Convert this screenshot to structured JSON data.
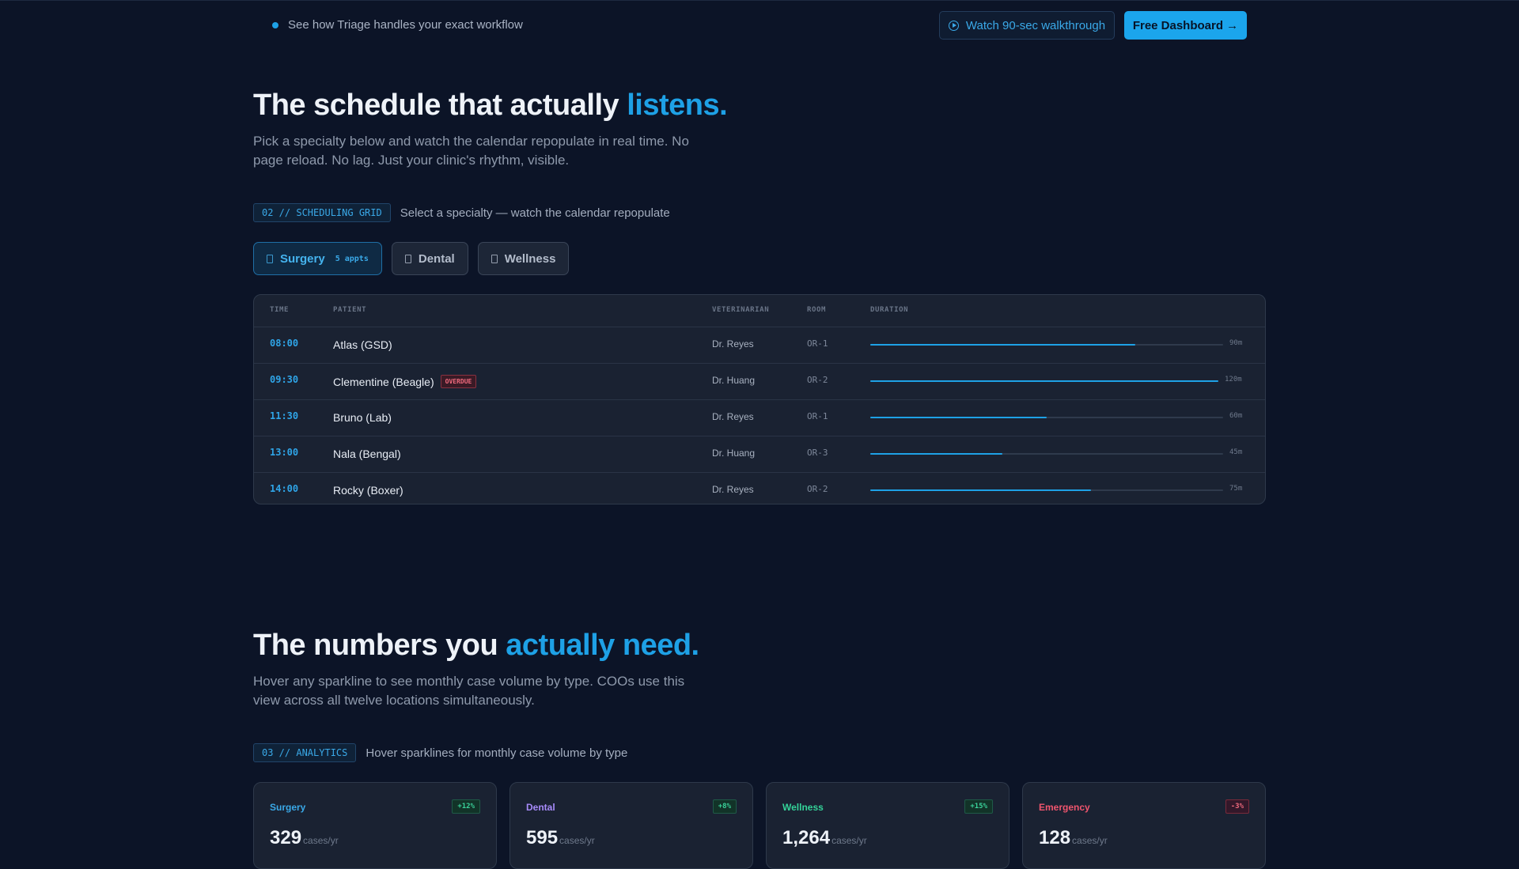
{
  "topbar": {
    "message": "See how Triage handles your exact workflow",
    "walkthrough_label": "Watch 90-sec walkthrough",
    "dashboard_label": "Free Dashboard →"
  },
  "scheduling": {
    "title_prefix": "The schedule that actually",
    "title_accent": "listens.",
    "lead": "Pick a specialty below and watch the calendar repopulate in real time. No page reload. No lag. Just your clinic's rhythm, visible.",
    "tag": "02 // SCHEDULING GRID",
    "tag_description": "Select a specialty — watch the calendar repopulate",
    "tabs": [
      {
        "label": "Surgery",
        "count": "5 appts",
        "active": true
      },
      {
        "label": "Dental",
        "count": "",
        "active": false
      },
      {
        "label": "Wellness",
        "count": "",
        "active": false
      }
    ],
    "columns": {
      "time": "TIME",
      "patient": "PATIENT",
      "vet": "VETERINARIAN",
      "room": "ROOM",
      "duration": "DURATION"
    },
    "overdue_label": "OVERDUE",
    "rows": [
      {
        "time": "08:00",
        "patient": "Atlas (GSD)",
        "overdue": false,
        "vet": "Dr. Reyes",
        "room": "OR-1",
        "duration": "90m",
        "minutes": 90
      },
      {
        "time": "09:30",
        "patient": "Clementine (Beagle)",
        "overdue": true,
        "vet": "Dr. Huang",
        "room": "OR-2",
        "duration": "120m",
        "minutes": 120
      },
      {
        "time": "11:30",
        "patient": "Bruno (Lab)",
        "overdue": false,
        "vet": "Dr. Reyes",
        "room": "OR-1",
        "duration": "60m",
        "minutes": 60
      },
      {
        "time": "13:00",
        "patient": "Nala (Bengal)",
        "overdue": false,
        "vet": "Dr. Huang",
        "room": "OR-3",
        "duration": "45m",
        "minutes": 45
      },
      {
        "time": "14:00",
        "patient": "Rocky (Boxer)",
        "overdue": false,
        "vet": "Dr. Reyes",
        "room": "OR-2",
        "duration": "75m",
        "minutes": 75
      }
    ],
    "accent_color": "#1ea1e6"
  },
  "analytics": {
    "title_prefix": "The numbers you",
    "title_accent": "actually need.",
    "lead": "Hover any sparkline to see monthly case volume by type. COOs use this view across all twelve locations simultaneously.",
    "tag": "03 // ANALYTICS",
    "tag_description": "Hover sparklines for monthly case volume by type",
    "unit": "cases/yr",
    "cards": [
      {
        "name": "Surgery",
        "change": "+12%",
        "trend": "up",
        "value": "329",
        "color": "#3aa9e8"
      },
      {
        "name": "Dental",
        "change": "+8%",
        "trend": "up",
        "value": "595",
        "color": "#a78bfa"
      },
      {
        "name": "Wellness",
        "change": "+15%",
        "trend": "up",
        "value": "1,264",
        "color": "#34d399"
      },
      {
        "name": "Emergency",
        "change": "-3%",
        "trend": "down",
        "value": "128",
        "color": "#f0556e"
      }
    ]
  }
}
